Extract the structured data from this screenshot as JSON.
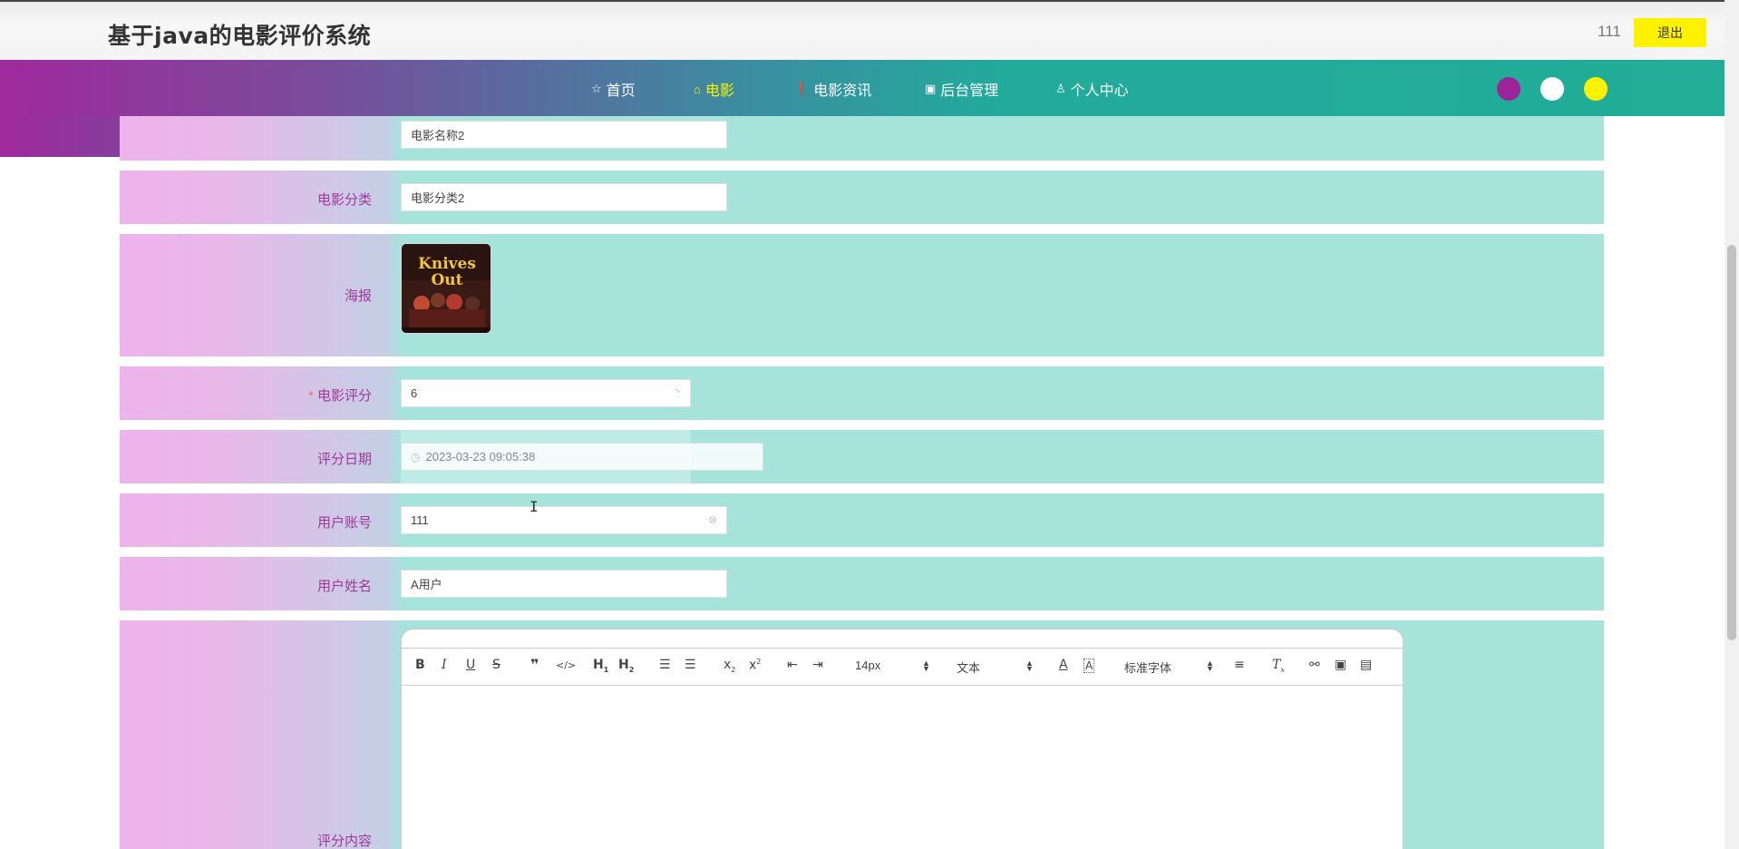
{
  "header": {
    "site_title": "基于java的电影评价系统",
    "user_name": "111",
    "logout_label": "退出"
  },
  "nav": {
    "items": [
      {
        "label": "首页",
        "icon": "star-icon",
        "glyph": "☆"
      },
      {
        "label": "电影",
        "icon": "bag-icon",
        "glyph": "⌂"
      },
      {
        "label": "电影资讯",
        "icon": "info-icon",
        "glyph": "❗"
      },
      {
        "label": "后台管理",
        "icon": "briefcase-icon",
        "glyph": "▣"
      },
      {
        "label": "个人中心",
        "icon": "user-icon",
        "glyph": "♙"
      }
    ],
    "active": "电影",
    "theme_colors": [
      "#9b2499",
      "#ffffff",
      "#fff200"
    ]
  },
  "form": {
    "movie_name": {
      "value": "电影名称2"
    },
    "movie_category": {
      "label": "电影分类",
      "value": "电影分类2"
    },
    "poster": {
      "label": "海报",
      "poster_title": "Knives Out"
    },
    "rating": {
      "label": "电影评分",
      "value": "6",
      "required": "*"
    },
    "rating_date": {
      "label": "评分日期",
      "value": "2023-03-23 09:05:38"
    },
    "user_account": {
      "label": "用户账号",
      "value": "111"
    },
    "user_name": {
      "label": "用户姓名",
      "value": "A用户"
    },
    "review_content": {
      "label": "评分内容"
    }
  },
  "editor": {
    "font_size": "14px",
    "block_type": "文本",
    "font_family": "标准字体",
    "tools": [
      "bold",
      "italic",
      "underline",
      "strike",
      "blockquote",
      "code-block",
      "header-1",
      "header-2",
      "ordered-list",
      "bullet-list",
      "subscript",
      "superscript",
      "outdent",
      "indent",
      "font-color",
      "background-color",
      "align",
      "clean",
      "link",
      "image",
      "video"
    ]
  },
  "colors": {
    "accent_yellow": "#fff200",
    "label_purple": "#a0389a",
    "row_teal": "#a6e3db",
    "row_pink": "#eeb3ec"
  }
}
